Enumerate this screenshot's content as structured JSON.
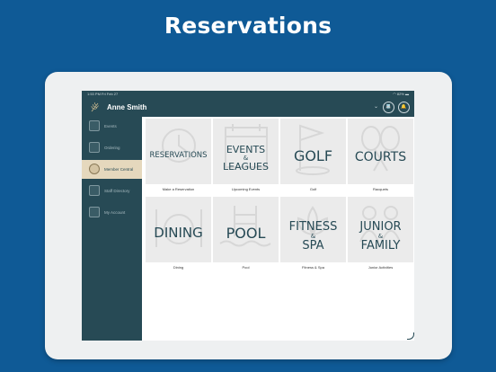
{
  "headline": "Reservations",
  "status": {
    "time": "1:53 PM",
    "date": "Fri Feb 27",
    "battery": "82%"
  },
  "header": {
    "user_name": "Anne Smith",
    "chevron": "⌄",
    "btn1": "📇",
    "btn2": "🔔"
  },
  "sidebar": {
    "items": [
      {
        "label": "Events",
        "icon": "calendar-icon"
      },
      {
        "label": "Ordering",
        "icon": "chef-icon"
      },
      {
        "label": "Member Central",
        "icon": "club-crest-icon",
        "active": true
      },
      {
        "label": "Staff Directory",
        "icon": "staff-directory-icon"
      },
      {
        "label": "My Account",
        "icon": "account-icon"
      }
    ]
  },
  "tiles": [
    {
      "title_line1": "RESERVATIONS",
      "caption": "Make a Reservation"
    },
    {
      "title_line1": "EVENTS",
      "amp": "&",
      "title_line2": "LEAGUES",
      "caption": "Upcoming Events"
    },
    {
      "title_line1": "GOLF",
      "caption": "Golf"
    },
    {
      "title_line1": "COURTS",
      "caption": "Racquets"
    },
    {
      "title_line1": "DINING",
      "caption": "Dining"
    },
    {
      "title_line1": "POOL",
      "caption": "Pool"
    },
    {
      "title_line1": "FITNESS",
      "amp": "&",
      "title_line2": "SPA",
      "caption": "Fitness & Spa"
    },
    {
      "title_line1": "JUNIOR",
      "amp": "&",
      "title_line2": "FAMILY",
      "caption": "Junior Activities"
    }
  ],
  "colors": {
    "brand_blue": "#0f5a96",
    "sidebar": "#274a55",
    "active_item": "#e5d8bd"
  }
}
